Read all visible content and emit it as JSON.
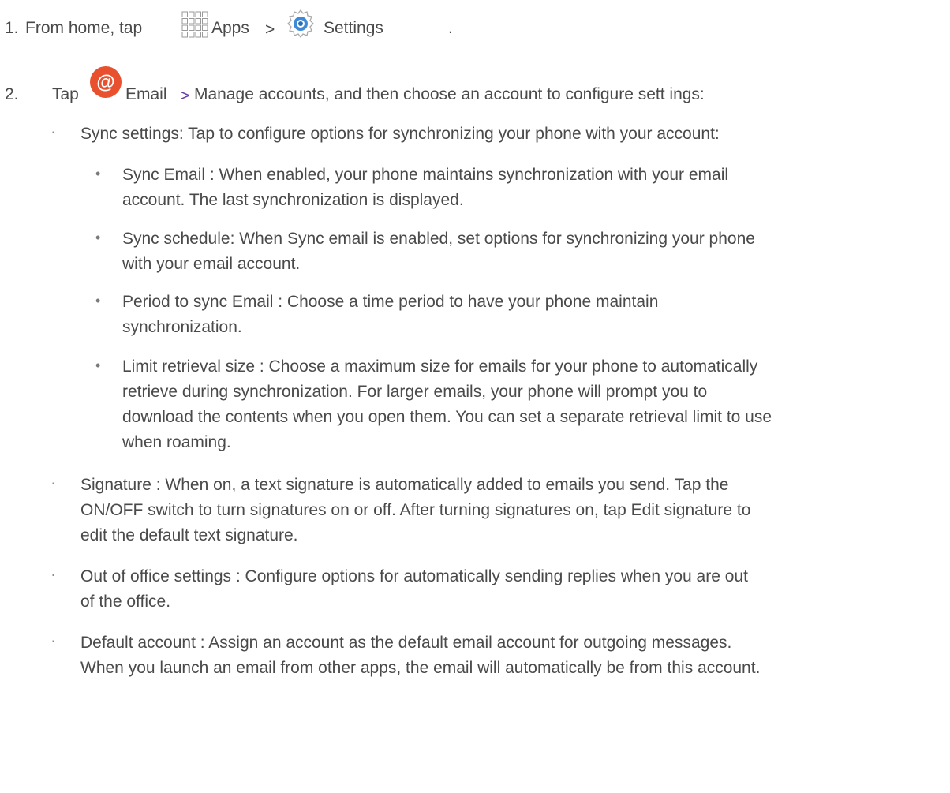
{
  "steps": [
    {
      "number": "1.",
      "lead": "From home, tap",
      "apps_label": "Apps",
      "sep": ">",
      "settings_label": "Settings",
      "end": "."
    },
    {
      "number": "2.",
      "lead": "Tap",
      "email_label": "Email",
      "sep": ">",
      "rest": "Manage accounts, and then choose an account to configure sett ings:"
    }
  ],
  "sync": {
    "intro": "Sync settings: Tap to configure options for synchronizing your phone with your account:",
    "items": [
      {
        "lines": [
          "Sync Email : When enabled, your phone maintains synchronization with your email",
          "account. The last synchronization is displayed."
        ]
      },
      {
        "lines": [
          "Sync schedule: When Sync email is enabled, set options for synchronizing your phone",
          "with your email account."
        ]
      },
      {
        "lines": [
          "Period to sync Email   : Choose a time period to have your phone maintain",
          "synchronization."
        ]
      },
      {
        "lines": [
          "Limit retrieval size   : Choose a maximum size for emails for your phone to automatically",
          "retrieve during synchronization. For larger emails, your phone will prompt you to",
          "download the contents when you open them. You can set a separate retrieval limit to use",
          "when roaming."
        ]
      }
    ]
  },
  "signature": {
    "lines": [
      "Signature : When on, a text signature is automatically added to emails you send. Tap the",
      "ON/OFF switch to turn signatures on or off. After turning signatures on, tap Edit signature   to",
      "edit the default text signature."
    ]
  },
  "out_of_office": {
    "lines": [
      "Out of office settings   : Configure options for automatically sending replies when you are out",
      "of the office."
    ]
  },
  "default_account": {
    "lines": [
      "Default account  : Assign an account as the default email account for outgoing messages.",
      "When you launch an email from other apps, the email will automatically be from this account."
    ]
  },
  "bullets": {
    "square": "▪",
    "dot": "•"
  },
  "icons": {
    "apps": "apps-grid-icon",
    "settings": "settings-gear-icon",
    "email": "email-at-icon",
    "email_color": "#e8502e"
  }
}
